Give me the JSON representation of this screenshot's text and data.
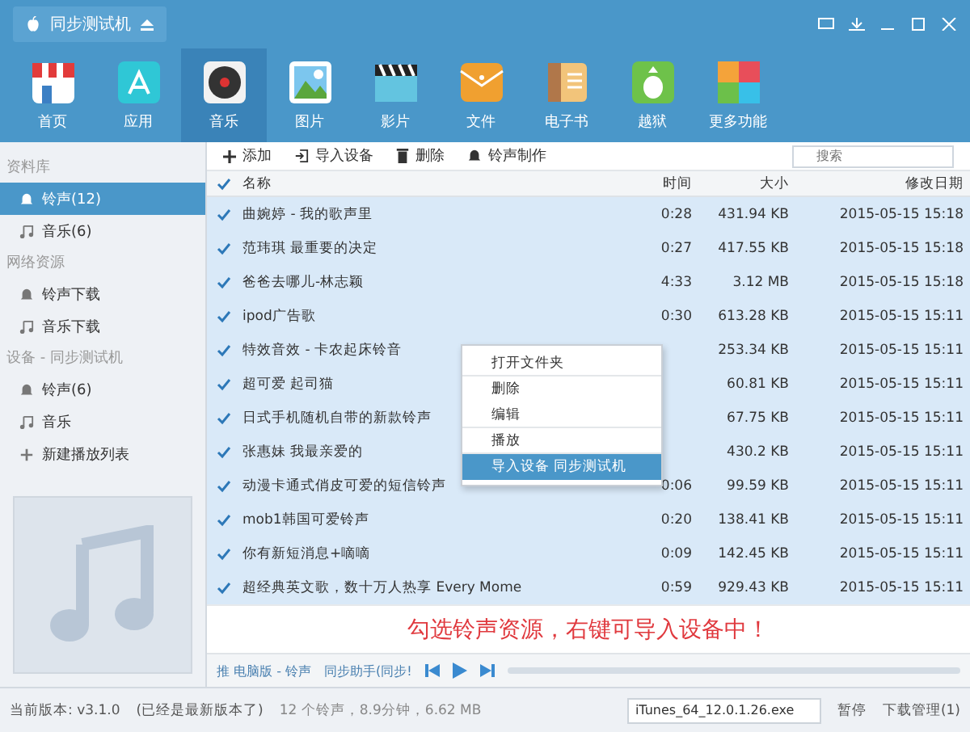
{
  "window": {
    "title": "同步测试机"
  },
  "nav": [
    {
      "label": "首页",
      "selected": false
    },
    {
      "label": "应用",
      "selected": false
    },
    {
      "label": "音乐",
      "selected": true
    },
    {
      "label": "图片",
      "selected": false
    },
    {
      "label": "影片",
      "selected": false
    },
    {
      "label": "文件",
      "selected": false
    },
    {
      "label": "电子书",
      "selected": false
    },
    {
      "label": "越狱",
      "selected": false
    },
    {
      "label": "更多功能",
      "selected": false
    }
  ],
  "sidebar": [
    {
      "heading": "资料库",
      "items": [
        {
          "label": "铃声(12)",
          "kind": "ringtone",
          "selected": true
        },
        {
          "label": "音乐(6)",
          "kind": "music",
          "selected": false
        }
      ]
    },
    {
      "heading": "网络资源",
      "items": [
        {
          "label": "铃声下载",
          "kind": "ringtone",
          "selected": false
        },
        {
          "label": "音乐下载",
          "kind": "music",
          "selected": false
        }
      ]
    },
    {
      "heading": "设备 - 同步测试机",
      "items": [
        {
          "label": "铃声(6)",
          "kind": "ringtone",
          "selected": false
        },
        {
          "label": "音乐",
          "kind": "music",
          "selected": false
        },
        {
          "label": "新建播放列表",
          "kind": "add",
          "selected": false
        }
      ]
    }
  ],
  "toolbar": [
    {
      "label": "添加",
      "kind": "add"
    },
    {
      "label": "导入设备",
      "kind": "import"
    },
    {
      "label": "删除",
      "kind": "delete"
    },
    {
      "label": "铃声制作",
      "kind": "make"
    }
  ],
  "search": {
    "placeholder": "搜索"
  },
  "table": {
    "all_checked": true,
    "columns": [
      "名称",
      "时间",
      "大小",
      "修改日期"
    ],
    "rows": [
      {
        "checked": true,
        "name": "曲婉婷 - 我的歌声里",
        "time": "0:28",
        "size": "431.94 KB",
        "date": "2015-05-15 15:18"
      },
      {
        "checked": true,
        "name": "范玮琪 最重要的决定",
        "time": "0:27",
        "size": "417.55 KB",
        "date": "2015-05-15 15:18"
      },
      {
        "checked": true,
        "name": "爸爸去哪儿-林志颖",
        "time": "4:33",
        "size": "3.12 MB",
        "date": "2015-05-15 15:18"
      },
      {
        "checked": true,
        "name": "ipod广告歌",
        "time": "0:30",
        "size": "613.28 KB",
        "date": "2015-05-15 15:11"
      },
      {
        "checked": true,
        "name": "特效音效 - 卡农起床铃音",
        "size": "253.34 KB",
        "date": "2015-05-15 15:11"
      },
      {
        "checked": true,
        "name": "超可爱 起司猫",
        "size": "60.81 KB",
        "date": "2015-05-15 15:11"
      },
      {
        "checked": true,
        "name": "日式手机随机自带的新款铃声",
        "size": "67.75 KB",
        "date": "2015-05-15 15:11"
      },
      {
        "checked": true,
        "name": "张惠妹 我最亲爱的",
        "size": "430.2 KB",
        "date": "2015-05-15 15:11"
      },
      {
        "checked": true,
        "name": "动漫卡通式俏皮可爱的短信铃声",
        "time": "0:06",
        "size": "99.59 KB",
        "date": "2015-05-15 15:11"
      },
      {
        "checked": true,
        "name": "mob1韩国可爱铃声",
        "time": "0:20",
        "size": "138.41 KB",
        "date": "2015-05-15 15:11"
      },
      {
        "checked": true,
        "name": "你有新短消息+嘀嘀",
        "time": "0:09",
        "size": "142.45 KB",
        "date": "2015-05-15 15:11"
      },
      {
        "checked": true,
        "name": "超经典英文歌，数十万人热享 Every Mome",
        "time": "0:59",
        "size": "929.43 KB",
        "date": "2015-05-15 15:11"
      }
    ]
  },
  "context_menu": [
    {
      "label": "打开文件夹",
      "selected": false,
      "divider_after": true
    },
    {
      "label": "删除",
      "selected": false,
      "divider_after": false
    },
    {
      "label": "编辑",
      "selected": false,
      "divider_after": true
    },
    {
      "label": "播放",
      "selected": false,
      "divider_after": true
    },
    {
      "label": "导入设备  同步测试机",
      "selected": true,
      "divider_after": false
    }
  ],
  "hint": "勾选铃声资源，右键可导入设备中！",
  "player": {
    "source": "推 电脑版 - 铃声",
    "track": "同步助手(同步!"
  },
  "status": {
    "version": "当前版本: v3.1.0",
    "version_note": "(已经是最新版本了)",
    "summary": "12 个铃声，8.9分钟，6.62 MB",
    "download_file": "iTunes_64_12.0.1.26.exe",
    "pause": "暂停",
    "downloads": "下载管理(1)"
  }
}
